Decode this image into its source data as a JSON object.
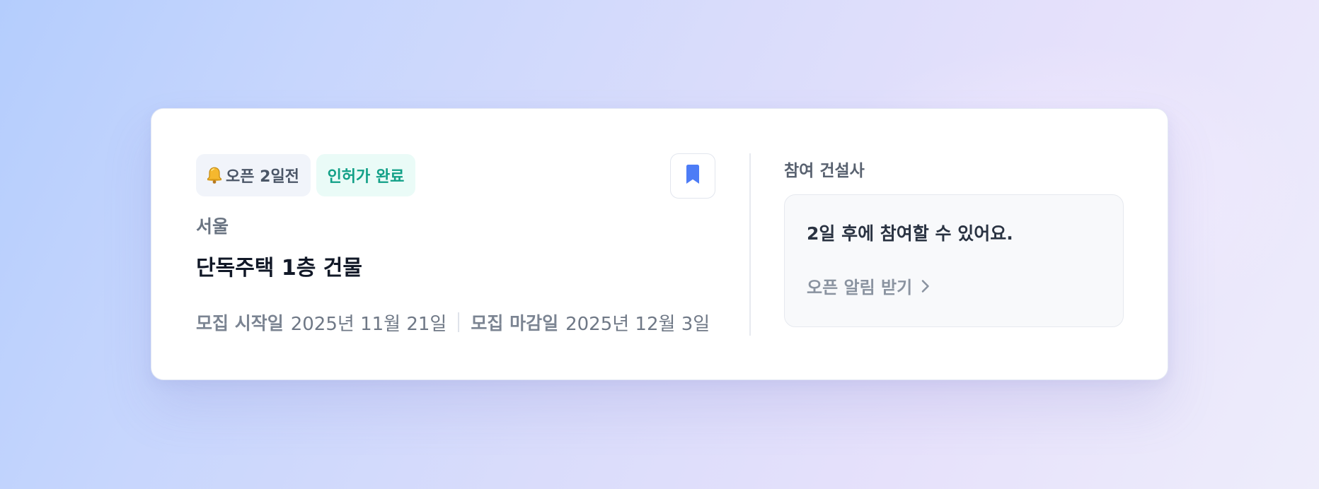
{
  "notice_card": {
    "open_chip": {
      "icon": "bell-icon",
      "label": "오픈 2일전"
    },
    "permit_chip": {
      "label": "인허가 완료",
      "color": "#12a087"
    },
    "bookmark": {
      "icon": "bookmark-icon",
      "color": "#4d7cf6"
    },
    "region": "서울",
    "title": "단독주택 1층 건물",
    "dates": {
      "start_label": "모집 시작일",
      "start_value": "2025년 11월 21일",
      "end_label": "모집 마감일",
      "end_value": "2025년 12월 3일"
    },
    "builders": {
      "title": "참여 건설사",
      "message": "2일 후에 참여할 수 있어요.",
      "link_label": "오픈 알림 받기",
      "link_icon": "chevron-right-icon"
    }
  }
}
